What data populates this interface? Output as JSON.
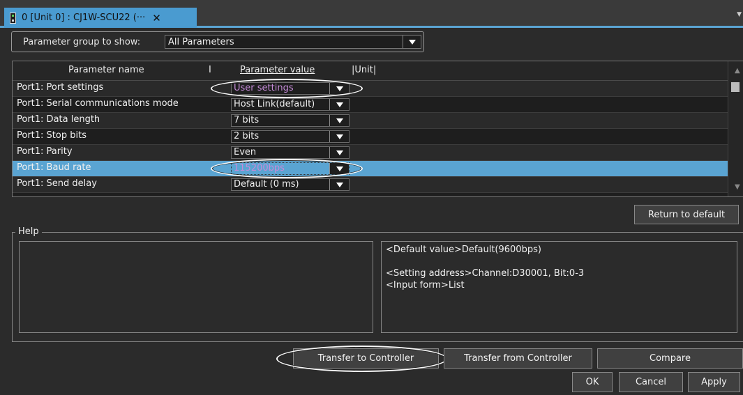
{
  "tab": {
    "title": "0 [Unit 0] : CJ1W-SCU22 (···",
    "close": "✕",
    "menu_glyph": "▼",
    "icon": "unit-icon"
  },
  "group": {
    "label": "Parameter group to show:",
    "value": "All Parameters"
  },
  "table": {
    "headers": {
      "name": "Parameter name",
      "sep": "I",
      "value": "Parameter value",
      "unit": "|Unit|"
    },
    "rows": [
      {
        "name": "Port1: Port settings",
        "value": "User settings"
      },
      {
        "name": "Port1: Serial communications mode",
        "value": "Host Link(default)"
      },
      {
        "name": "Port1: Data length",
        "value": "7 bits"
      },
      {
        "name": "Port1: Stop bits",
        "value": "2 bits"
      },
      {
        "name": "Port1: Parity",
        "value": "Even"
      },
      {
        "name": "Port1: Baud rate",
        "value": "115200bps"
      },
      {
        "name": "Port1: Send delay",
        "value": "Default (0 ms)"
      }
    ],
    "selected_row": "Port1: Baud rate",
    "custom_value_color": "#c58bd8",
    "selection_color": "#5aa4d2"
  },
  "return_default_label": "Return to default",
  "help": {
    "title": "Help",
    "lines": [
      "<Default value>Default(9600bps)",
      "",
      "<Setting address>Channel:D30001, Bit:0-3",
      "<Input form>List"
    ]
  },
  "buttons": {
    "transfer_to": "Transfer to Controller",
    "transfer_from": "Transfer from Controller",
    "compare": "Compare",
    "ok": "OK",
    "cancel": "Cancel",
    "apply": "Apply"
  }
}
